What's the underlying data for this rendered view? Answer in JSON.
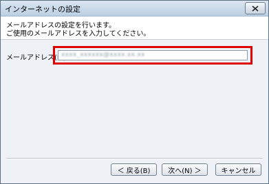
{
  "window": {
    "title": "インターネットの設定",
    "close_icon": "close-icon"
  },
  "header": {
    "line1": "メールアドレスの設定を行います。",
    "line2": "ご使用のメールアドレスを入力してください。"
  },
  "form": {
    "email_label": "メールアドレス(M)：",
    "email_value": "xxxx_xxxxxx@xxxx.xx.xx"
  },
  "buttons": {
    "back": "＜ 戻る(B)",
    "next": "次へ(N) ＞",
    "cancel": "キャンセル"
  },
  "colors": {
    "highlight": "#e00000"
  }
}
